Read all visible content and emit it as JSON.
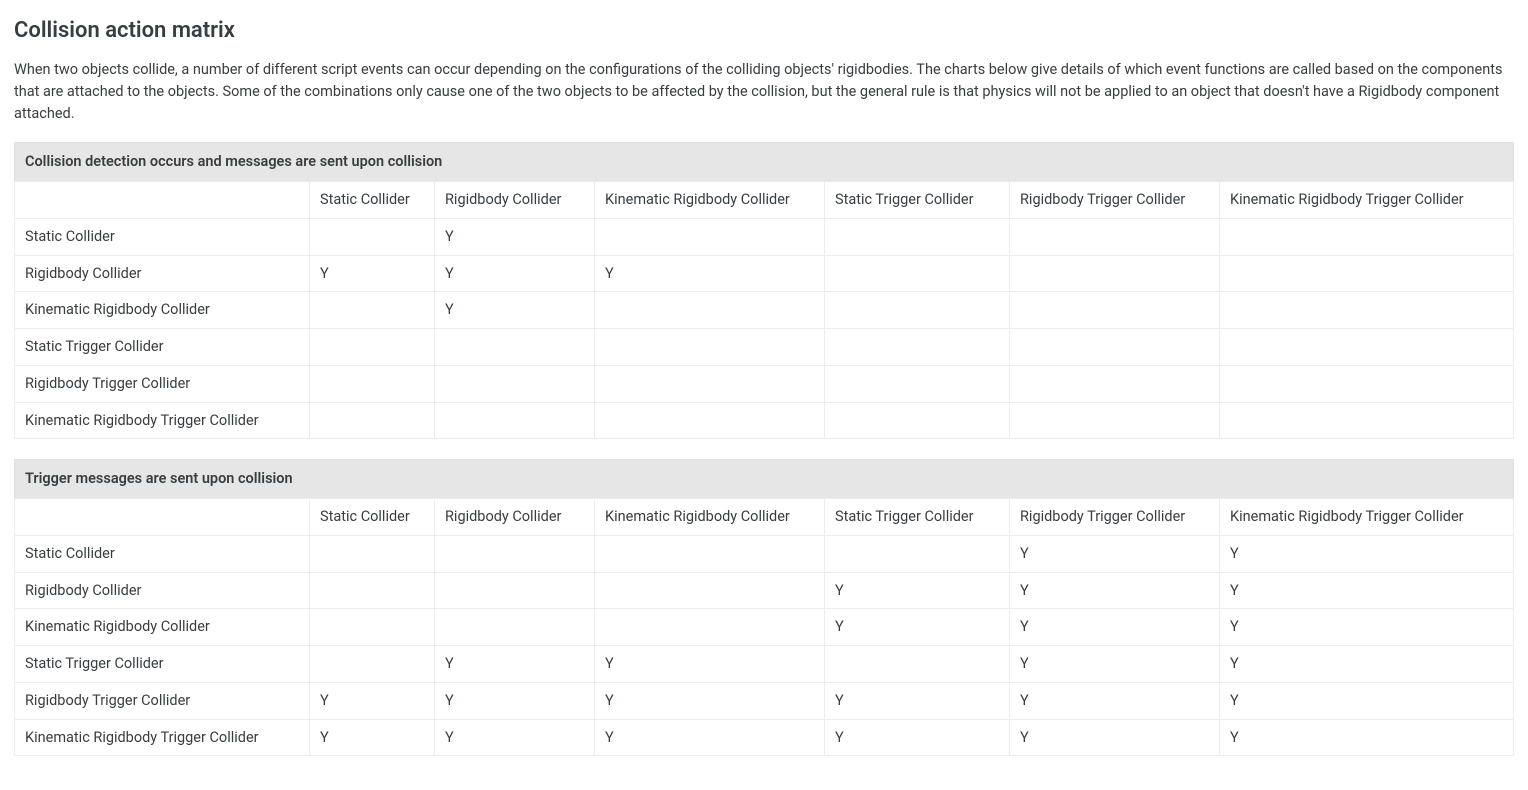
{
  "heading": "Collision action matrix",
  "intro": "When two objects collide, a number of different script events can occur depending on the configurations of the colliding objects' rigidbodies. The charts below give details of which event functions are called based on the components that are attached to the objects. Some of the combinations only cause one of the two objects to be affected by the collision, but the general rule is that physics will not be applied to an object that doesn't have a Rigidbody component attached.",
  "columns": [
    "Static Collider",
    "Rigidbody Collider",
    "Kinematic Rigidbody Collider",
    "Static Trigger Collider",
    "Rigidbody Trigger Collider",
    "Kinematic Rigidbody Trigger Collider"
  ],
  "rowLabels": [
    "Static Collider",
    "Rigidbody Collider",
    "Kinematic Rigidbody Collider",
    "Static Trigger Collider",
    "Rigidbody Trigger Collider",
    "Kinematic Rigidbody Trigger Collider"
  ],
  "tables": [
    {
      "caption": "Collision detection occurs and messages are sent upon collision",
      "rows": [
        [
          "",
          "Y",
          "",
          "",
          "",
          ""
        ],
        [
          "Y",
          "Y",
          "Y",
          "",
          "",
          ""
        ],
        [
          "",
          "Y",
          "",
          "",
          "",
          ""
        ],
        [
          "",
          "",
          "",
          "",
          "",
          ""
        ],
        [
          "",
          "",
          "",
          "",
          "",
          ""
        ],
        [
          "",
          "",
          "",
          "",
          "",
          ""
        ]
      ]
    },
    {
      "caption": "Trigger messages are sent upon collision",
      "rows": [
        [
          "",
          "",
          "",
          "",
          "Y",
          "Y"
        ],
        [
          "",
          "",
          "",
          "Y",
          "Y",
          "Y"
        ],
        [
          "",
          "",
          "",
          "Y",
          "Y",
          "Y"
        ],
        [
          "",
          "Y",
          "Y",
          "",
          "Y",
          "Y"
        ],
        [
          "Y",
          "Y",
          "Y",
          "Y",
          "Y",
          "Y"
        ],
        [
          "Y",
          "Y",
          "Y",
          "Y",
          "Y",
          "Y"
        ]
      ]
    }
  ]
}
